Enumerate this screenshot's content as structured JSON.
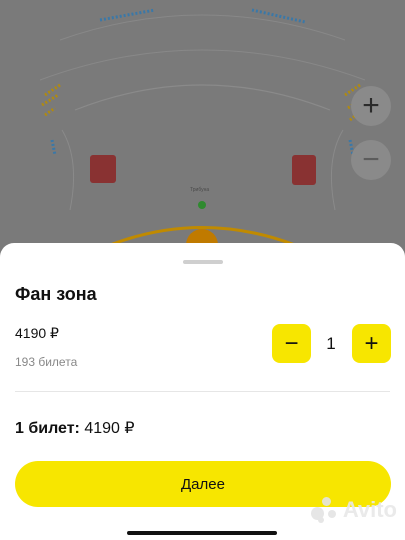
{
  "map": {
    "stage_label": "Трибуна"
  },
  "zoom": {
    "in_label": "+",
    "out_label": "−"
  },
  "sheet": {
    "zone_title": "Фан зона",
    "price": "4190 ₽",
    "tickets_left": "193 билета",
    "stepper": {
      "minus": "−",
      "quantity": "1",
      "plus": "+"
    },
    "total_label": "1 билет:",
    "total_value": "4190 ₽",
    "cta_label": "Далее"
  },
  "watermark": {
    "text": "Avito"
  },
  "colors": {
    "accent": "#f7e600",
    "map_overlay": "#7a7a7a"
  }
}
